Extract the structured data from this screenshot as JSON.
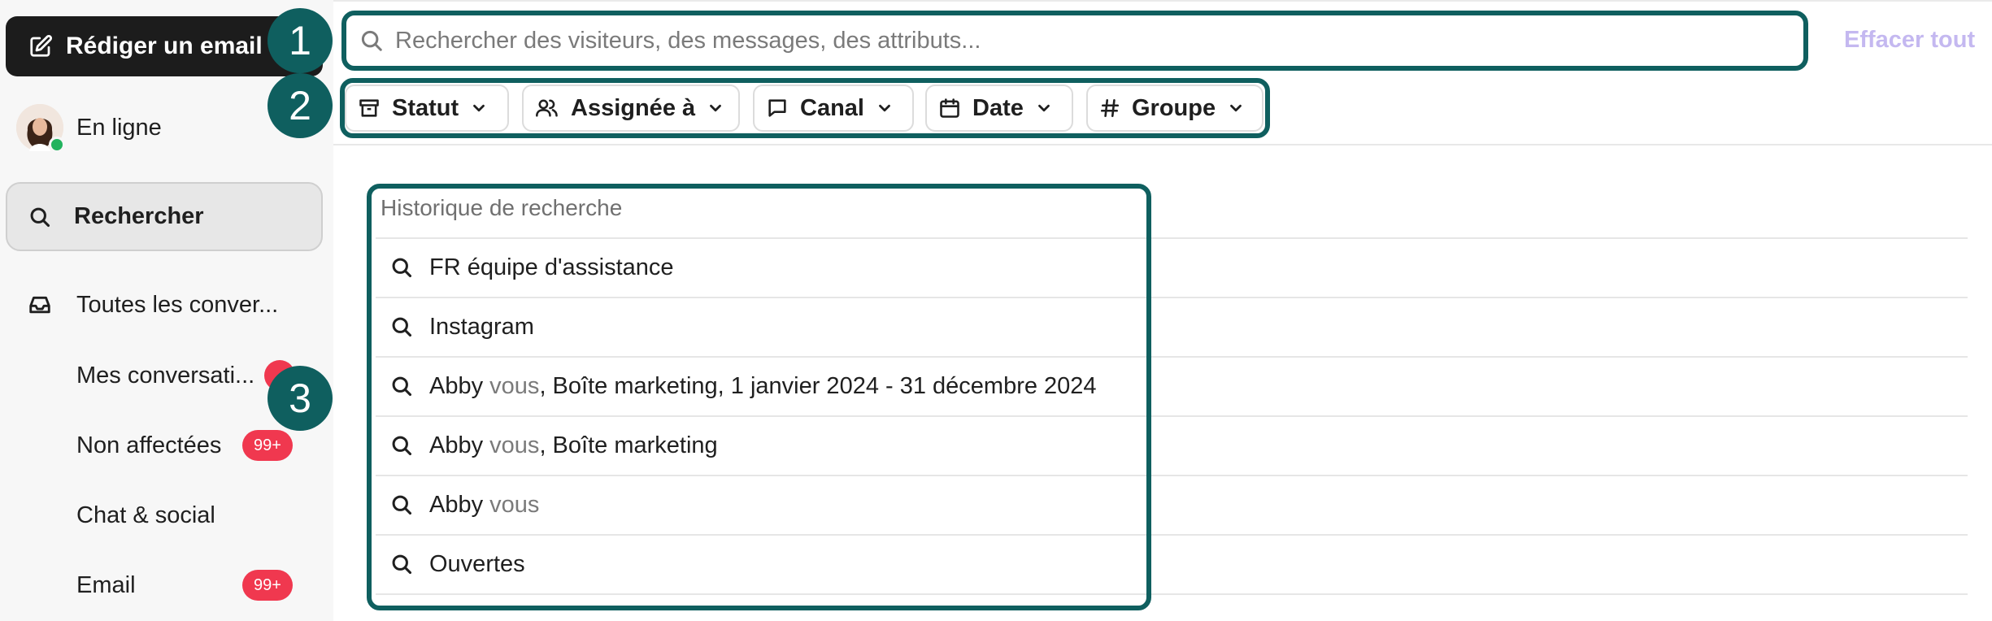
{
  "sidebar": {
    "compose_label": "Rédiger un email",
    "presence_label": "En ligne",
    "search_label": "Rechercher",
    "items": [
      {
        "label": "Toutes les conver...",
        "icon": "inbox-icon"
      },
      {
        "label": "Mes conversati...",
        "badge": ""
      },
      {
        "label": "Non affectées",
        "badge": "99+"
      },
      {
        "label": "Chat & social"
      },
      {
        "label": "Email",
        "badge": "99+"
      }
    ]
  },
  "search": {
    "placeholder": "Rechercher des visiteurs, des messages, des attributs...",
    "value": "",
    "clear_all": "Effacer tout"
  },
  "filters": [
    {
      "label": "Statut",
      "icon": "archive-icon"
    },
    {
      "label": "Assignée à",
      "icon": "users-icon"
    },
    {
      "label": "Canal",
      "icon": "message-icon"
    },
    {
      "label": "Date",
      "icon": "calendar-icon"
    },
    {
      "label": "Groupe",
      "icon": "hash-icon"
    }
  ],
  "history": {
    "title": "Historique de recherche",
    "rows": [
      {
        "main": "FR équipe d'assistance",
        "muted": "",
        "rest": ""
      },
      {
        "main": "Instagram",
        "muted": "",
        "rest": ""
      },
      {
        "main": "Abby",
        "muted": "vous",
        "rest": ", Boîte marketing, 1 janvier 2024 - 31 décembre 2024"
      },
      {
        "main": "Abby",
        "muted": "vous",
        "rest": ", Boîte marketing"
      },
      {
        "main": "Abby",
        "muted": "vous",
        "rest": ""
      },
      {
        "main": "Ouvertes",
        "muted": "",
        "rest": ""
      }
    ]
  },
  "callouts": [
    "1",
    "2",
    "3"
  ],
  "colors": {
    "accent": "#0f5f5f",
    "badge": "#f0384f",
    "online": "#22b35e",
    "clear_all": "#c4b8f0"
  }
}
